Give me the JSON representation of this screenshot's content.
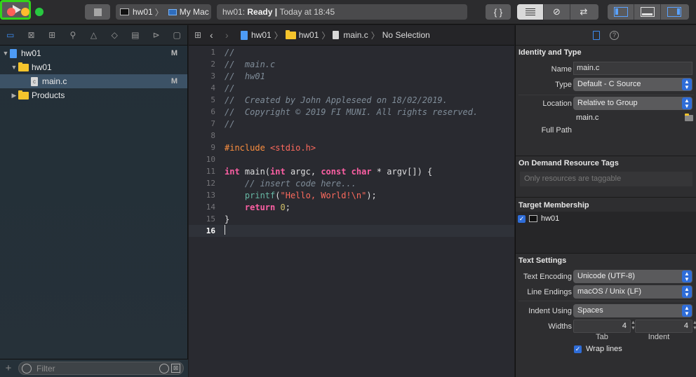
{
  "toolbar": {
    "scheme_target": "hw01",
    "scheme_destination": "My Mac",
    "status_project": "hw01:",
    "status_state": "Ready",
    "status_sep": "|",
    "status_time": "Today at 18:45",
    "library_label": "{ }",
    "review_label": "⇄",
    "related_label": "⊘"
  },
  "navigator": {
    "tree": [
      {
        "label": "hw01",
        "badge": "M"
      },
      {
        "label": "hw01"
      },
      {
        "label": "main.c",
        "badge": "M",
        "file_letter": "c"
      },
      {
        "label": "Products"
      }
    ],
    "filter_placeholder": "Filter",
    "add_label": "+"
  },
  "jumpbar": {
    "project": "hw01",
    "group": "hw01",
    "file": "main.c",
    "selection": "No Selection"
  },
  "code": {
    "line_numbers": [
      "1",
      "2",
      "3",
      "4",
      "5",
      "6",
      "7",
      "8",
      "9",
      "10",
      "11",
      "12",
      "13",
      "14",
      "15",
      "16"
    ],
    "l1": "//",
    "l2": "//  main.c",
    "l3": "//  hw01",
    "l4": "//",
    "l5": "//  Created by John Appleseed on 18/02/2019.",
    "l6": "//  Copyright © 2019 FI MUNI. All rights reserved.",
    "l7": "//",
    "l9_directive": "#include",
    "l9_header": "<stdio.h>",
    "l11_int1": "int",
    "l11_main": " main(",
    "l11_int2": "int",
    "l11_argc": " argc, ",
    "l11_const": "const",
    "l11_sp": " ",
    "l11_char": "char",
    "l11_rest": " * argv[]) {",
    "l12": "    // insert code here...",
    "l13_indent": "    ",
    "l13_fn": "printf",
    "l13_open": "(",
    "l13_str": "\"Hello, World!\\n\"",
    "l13_close": ");",
    "l14_indent": "    ",
    "l14_kw": "return",
    "l14_sp": " ",
    "l14_num": "0",
    "l14_semi": ";",
    "l15": "}"
  },
  "inspector": {
    "identity_title": "Identity and Type",
    "name_label": "Name",
    "name_value": "main.c",
    "type_label": "Type",
    "type_value": "Default - C Source",
    "location_label": "Location",
    "location_value": "Relative to Group",
    "location_file": "main.c",
    "full_path_label": "Full Path",
    "tags_title": "On Demand Resource Tags",
    "tags_placeholder": "Only resources are taggable",
    "membership_title": "Target Membership",
    "membership_target": "hw01",
    "text_title": "Text Settings",
    "encoding_label": "Text Encoding",
    "encoding_value": "Unicode (UTF-8)",
    "line_endings_label": "Line Endings",
    "line_endings_value": "macOS / Unix (LF)",
    "indent_label": "Indent Using",
    "indent_value": "Spaces",
    "widths_label": "Widths",
    "tab_width": "4",
    "indent_width": "4",
    "tab_label": "Tab",
    "indent_sub_label": "Indent",
    "wrap_label": "Wrap lines"
  }
}
